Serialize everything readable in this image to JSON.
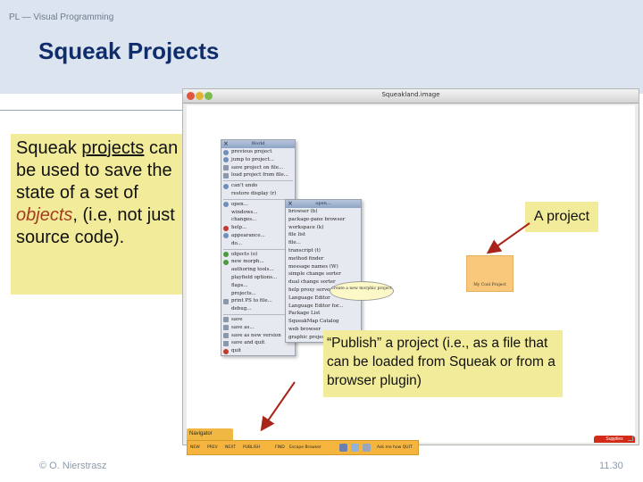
{
  "header": {
    "course": "PL — Visual Programming",
    "title": "Squeak Projects"
  },
  "main_callout": {
    "part1": "Squeak ",
    "underlined": "projects",
    "part2": " can be used to save the state of a set of ",
    "italic": "objects",
    "part3": ", (i.e, not just source code)."
  },
  "squeak_window": {
    "title": "Squeakland.image",
    "world_menu": {
      "title": "World",
      "items": [
        {
          "label": "previous project",
          "icon": "project-icon"
        },
        {
          "label": "jump to project...",
          "icon": "project-icon"
        },
        {
          "label": "save project on file...",
          "icon": "save-icon"
        },
        {
          "label": "load project from file...",
          "icon": "load-icon"
        },
        {
          "label": "sep"
        },
        {
          "label": "can't undo",
          "icon": "undo-icon"
        },
        {
          "label": "restore display (r)",
          "icon": ""
        },
        {
          "label": "sep"
        },
        {
          "label": "open...",
          "icon": "open-icon"
        },
        {
          "label": "windows...",
          "icon": ""
        },
        {
          "label": "changes...",
          "icon": ""
        },
        {
          "label": "help...",
          "icon": "help-icon"
        },
        {
          "label": "appearance...",
          "icon": "appearance-icon"
        },
        {
          "label": "do...",
          "icon": ""
        },
        {
          "label": "sep"
        },
        {
          "label": "objects (o)",
          "icon": "objects-icon"
        },
        {
          "label": "new morph...",
          "icon": "morph-icon"
        },
        {
          "label": "authoring tools...",
          "icon": ""
        },
        {
          "label": "playfield options...",
          "icon": ""
        },
        {
          "label": "flaps...",
          "icon": ""
        },
        {
          "label": "projects...",
          "icon": ""
        },
        {
          "label": "print PS to file...",
          "icon": "print-icon"
        },
        {
          "label": "debug...",
          "icon": ""
        },
        {
          "label": "sep"
        },
        {
          "label": "save",
          "icon": "save-icon"
        },
        {
          "label": "save as...",
          "icon": "save-icon"
        },
        {
          "label": "save as new version",
          "icon": "save-icon"
        },
        {
          "label": "save and quit",
          "icon": "save-icon"
        },
        {
          "label": "quit",
          "icon": "quit-icon"
        }
      ]
    },
    "open_menu": {
      "title": "open...",
      "items": [
        "browser (b)",
        "package-pane browser",
        "workspace (k)",
        "file list",
        "file...",
        "transcript (t)",
        "method finder",
        "message names (W)",
        "simple change sorter",
        "dual change sorter",
        "help proxy server",
        "Language Editor",
        "Language Editor for...",
        "Package List",
        "SqueakMap Catalog",
        "web browser",
        "graphic project"
      ]
    },
    "balloon_text": "create a new morphic project",
    "project_thumbnail_label": "My Cool Project",
    "navigator": {
      "tab": "Navigator",
      "buttons": [
        "NEW",
        "PREV",
        "NEXT",
        "PUBLISH",
        "FIND",
        "Escape Browser"
      ],
      "zoom": "Ask me how QUIT"
    },
    "flaps_tab": "Supplies"
  },
  "callouts": {
    "project": "A project",
    "publish": "“Publish” a project (i.e., as a file that can be loaded from Squeak or from a browser plugin)"
  },
  "footer": {
    "copyright": "© O. Nierstrasz",
    "page": "11.30"
  },
  "colors": {
    "header_band": "#dbe4ef",
    "title_text": "#0f2d6b",
    "callout_bg": "#f2ec9a",
    "arrow": "#a9251a",
    "accent_text": "#a43a1e",
    "navigator_bar": "#f4b43d"
  }
}
